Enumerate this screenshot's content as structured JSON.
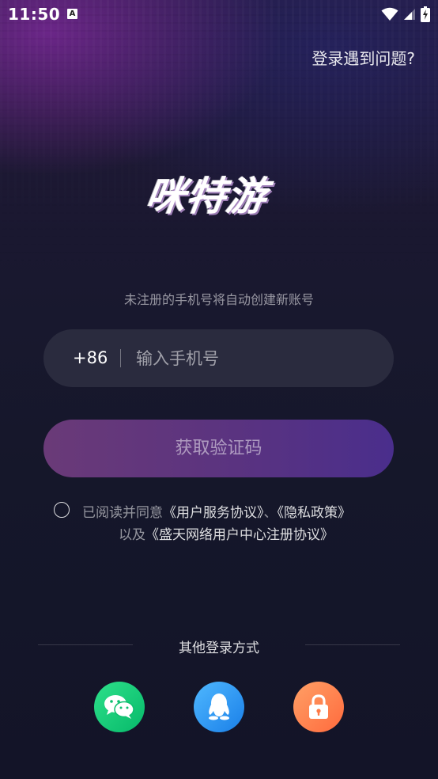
{
  "status_bar": {
    "time": "11:50",
    "notification_badge": "A"
  },
  "header": {
    "trouble_link": "登录遇到问题?"
  },
  "logo": {
    "text": "咪特游"
  },
  "form": {
    "hint": "未注册的手机号将自动创建新账号",
    "country_code": "+86",
    "phone_placeholder": "输入手机号",
    "get_code_label": "获取验证码"
  },
  "agreement": {
    "prefix": "已阅读并同意",
    "user_service": "《用户服务协议》",
    "separator": "、",
    "privacy": "《隐私政策》",
    "line2_prefix": "以及",
    "registration": "《盛天网络用户中心注册协议》"
  },
  "other_login": {
    "title": "其他登录方式",
    "methods": [
      {
        "icon": "wechat-icon",
        "color": "#07c160"
      },
      {
        "icon": "qq-icon",
        "color": "#2a8ef2"
      },
      {
        "icon": "lock-icon",
        "color": "#ff7a45"
      }
    ]
  }
}
